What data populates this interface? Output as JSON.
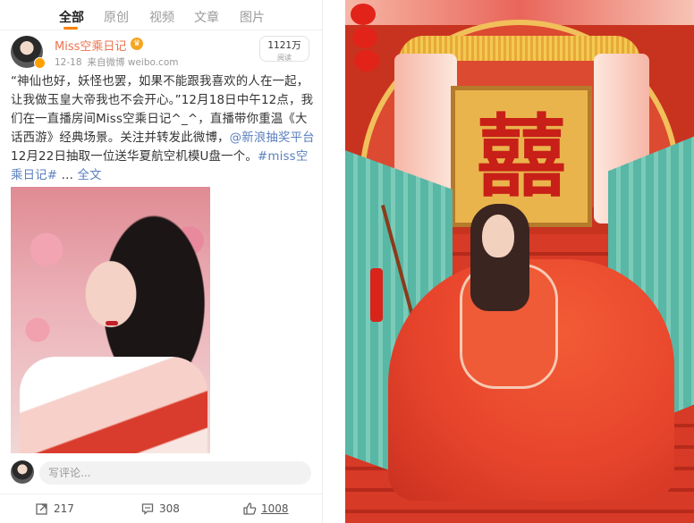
{
  "tabs": [
    {
      "label": "全部",
      "active": true
    },
    {
      "label": "原创",
      "active": false
    },
    {
      "label": "视频",
      "active": false
    },
    {
      "label": "文章",
      "active": false
    },
    {
      "label": "图片",
      "active": false
    }
  ],
  "post": {
    "author": "Miss空乘日记",
    "date": "12-18",
    "source": "来自微博 weibo.com",
    "reads_count": "1121万",
    "reads_label": "阅读",
    "text_1": "“神仙也好，妖怪也罢，如果不能跟我喜欢的人在一起，让我做玉皇大帝我也不会开心。”12月18日中午12点，我们在一直播房间Miss空乘日记^_^，直播带你重温《大话西游》经典场景。关注并转发此微博，",
    "mention": "@新浪抽奖平台",
    "text_2": " 12月22日抽取一位送华夏航空机模U盘一个。",
    "hashtag": "#miss空乘日记#",
    "ellipsis": " ... ",
    "more_link": "全文"
  },
  "comment": {
    "placeholder": "写评论..."
  },
  "actions": {
    "repost_count": "217",
    "comment_count": "308",
    "like_count": "1008"
  },
  "photo": {
    "plaque_char": "囍"
  },
  "colors": {
    "accent": "#ff8200",
    "username": "#eb7350",
    "link": "#5b7fbf"
  }
}
